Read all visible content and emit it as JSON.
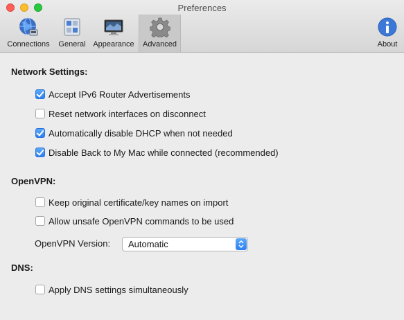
{
  "window": {
    "title": "Preferences"
  },
  "toolbar": {
    "items": [
      {
        "label": "Connections",
        "icon": "globe-network-icon"
      },
      {
        "label": "General",
        "icon": "switch-panel-icon"
      },
      {
        "label": "Appearance",
        "icon": "display-icon"
      },
      {
        "label": "Advanced",
        "icon": "gear-icon",
        "selected": true
      }
    ],
    "about": {
      "label": "About",
      "icon": "info-icon"
    }
  },
  "network": {
    "title": "Network Settings:",
    "options": [
      {
        "label": "Accept IPv6 Router Advertisements",
        "checked": true
      },
      {
        "label": "Reset network interfaces on disconnect",
        "checked": false
      },
      {
        "label": "Automatically disable DHCP when not needed",
        "checked": true
      },
      {
        "label": "Disable Back to My Mac while connected (recommended)",
        "checked": true
      }
    ]
  },
  "openvpn": {
    "title": "OpenVPN:",
    "options": [
      {
        "label": "Keep original certificate/key names on import",
        "checked": false
      },
      {
        "label": "Allow unsafe OpenVPN commands to be used",
        "checked": false
      }
    ],
    "version_label": "OpenVPN Version:",
    "version_value": "Automatic"
  },
  "dns": {
    "title": "DNS:",
    "options": [
      {
        "label": "Apply DNS settings simultaneously",
        "checked": false
      }
    ]
  },
  "colors": {
    "accent": "#2c80f2",
    "close": "#fc5f57",
    "minimize": "#fdbc2e",
    "maximize": "#29c840"
  }
}
